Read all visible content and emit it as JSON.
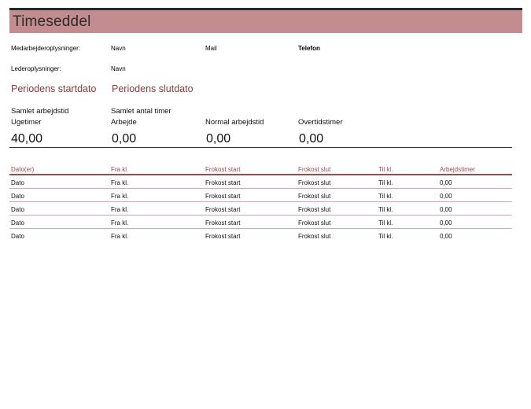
{
  "title": "Timeseddel",
  "info": {
    "employee_label": "Medarbejderoplysninger:",
    "employee_name": "Navn",
    "employee_mail": "Mail",
    "employee_phone": "Telefon",
    "manager_label": "Lederoplysninger:",
    "manager_name": "Navn"
  },
  "period": {
    "start": "Periodens startdato",
    "end": "Periodens slutdato"
  },
  "summary": {
    "col1_label_line1": "Samlet arbejdstid",
    "col1_label_line2": "Ugetimer",
    "col1_value": "40,00",
    "col2_label_line1": "Samlet antal timer",
    "col2_label_line2": "Arbejde",
    "col2_value": "0,00",
    "col3_label": "Normal arbejdstid",
    "col3_value": "0,00",
    "col4_label": "Overtidstimer",
    "col4_value": "0,00"
  },
  "table": {
    "headers": [
      "Dato(er)",
      "Fra kl.",
      "Frokost start",
      "Frokost slut",
      "Til kl.",
      "Arbejdstimer"
    ],
    "rows": [
      [
        "Dato",
        "Fra kl.",
        "Frokost start",
        "Frokost slut",
        "Til kl.",
        "0,00"
      ],
      [
        "Dato",
        "Fra kl.",
        "Frokost start",
        "Frokost slut",
        "Til kl.",
        "0,00"
      ],
      [
        "Dato",
        "Fra kl.",
        "Frokost start",
        "Frokost slut",
        "Til kl.",
        "0,00"
      ],
      [
        "Dato",
        "Fra kl.",
        "Frokost start",
        "Frokost slut",
        "Til kl.",
        "0,00"
      ],
      [
        "Dato",
        "Fra kl.",
        "Frokost start",
        "Frokost slut",
        "Til kl.",
        "0,00"
      ]
    ]
  },
  "colors": {
    "accent": "#c38c8e",
    "accent_text": "#8b3a3c"
  }
}
